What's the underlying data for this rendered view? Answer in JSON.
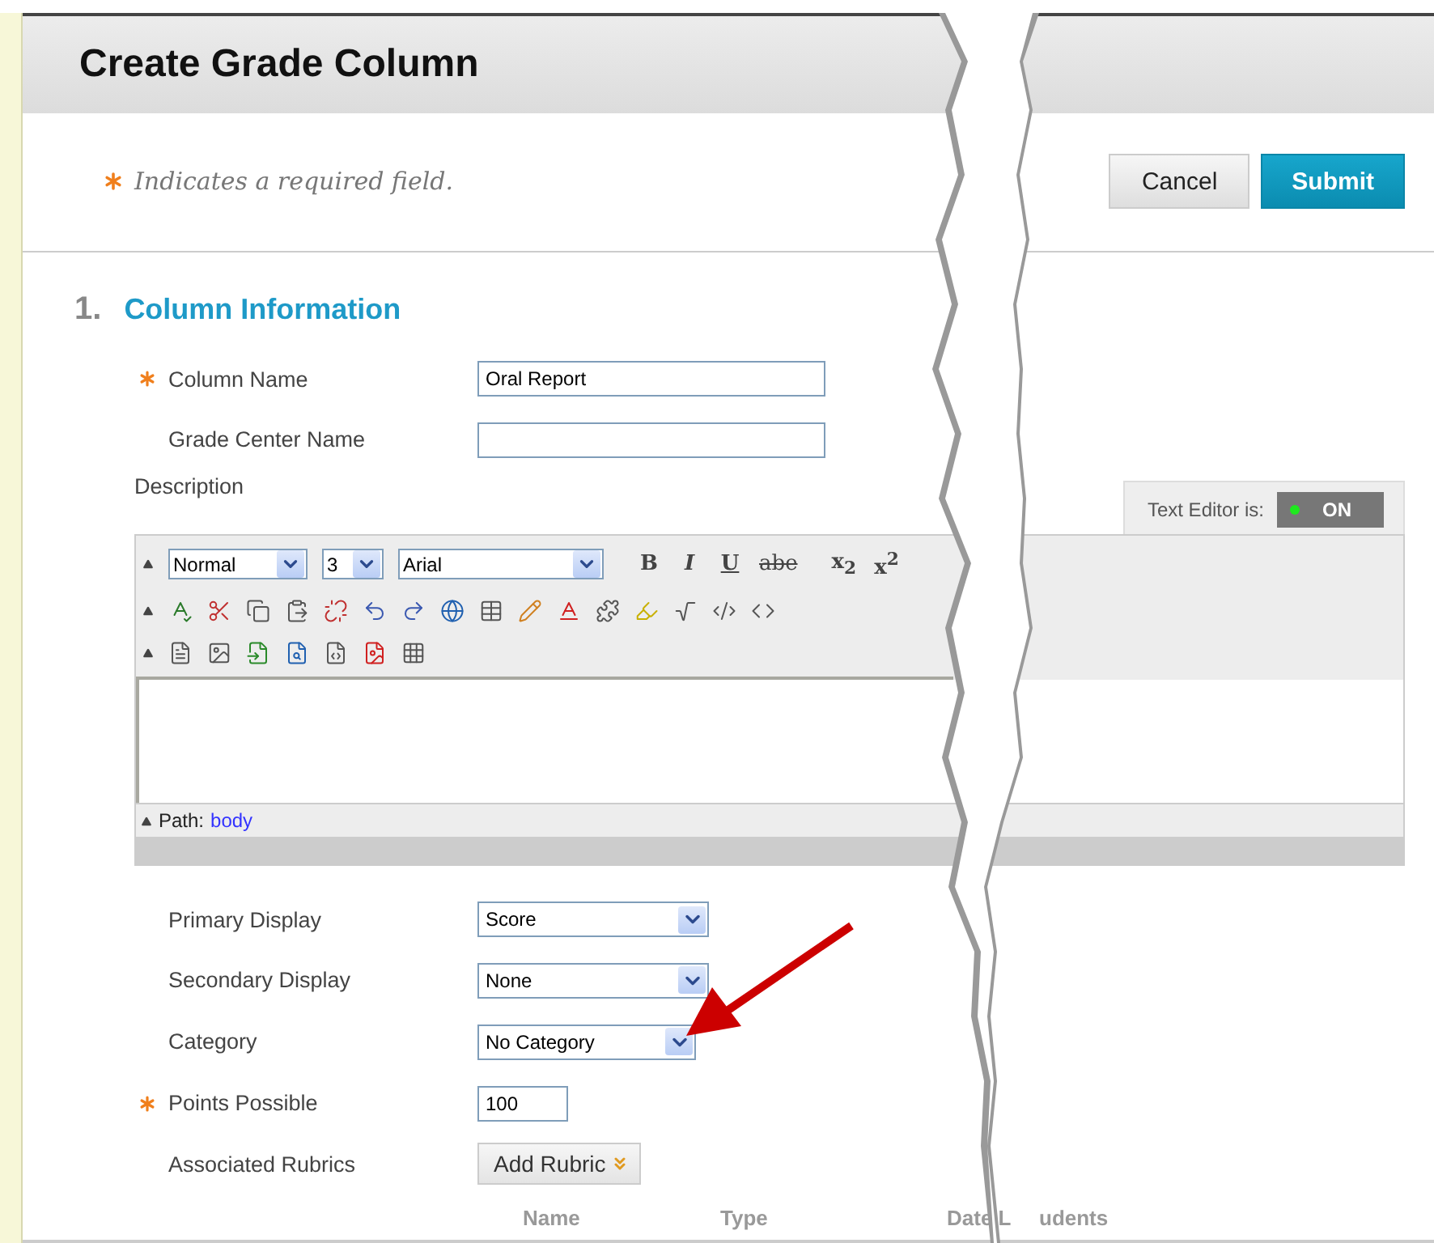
{
  "page": {
    "title": "Create Grade Column"
  },
  "required_note": {
    "text": "Indicates a required field."
  },
  "buttons": [
    {
      "label": "Cancel",
      "kind": "secondary"
    },
    {
      "label": "Submit",
      "kind": "primary"
    }
  ],
  "section": {
    "number": "1.",
    "title": "Column Information"
  },
  "fields_top": [
    {
      "kind": "text",
      "label": "Column Name",
      "required": true,
      "value": "Oral Report"
    },
    {
      "kind": "text",
      "label": "Grade Center Name",
      "required": false
    }
  ],
  "description": {
    "label": "Description"
  },
  "text_editor_toggle": {
    "label": "Text Editor is:",
    "state_text": "ON",
    "on": true
  },
  "editor": {
    "paragraph": "Normal",
    "size": "3",
    "font": "Arial",
    "format_buttons": [
      "B",
      "I",
      "U",
      "abe",
      "x$_{2}$",
      "x$^{2}$"
    ],
    "path_label": "Path:",
    "path": "body"
  },
  "fields_bottom": [
    {
      "kind": "select",
      "label": "Primary Display",
      "required": false,
      "value": "Score"
    },
    {
      "kind": "select",
      "label": "Secondary Display",
      "required": false,
      "value": "None"
    },
    {
      "kind": "select",
      "label": "Category",
      "required": false,
      "value": "No Category"
    },
    {
      "kind": "text",
      "label": "Points Possible",
      "required": true,
      "value": "100"
    },
    {
      "kind": "button",
      "label": "Associated Rubrics",
      "required": false,
      "value": "Add Rubric"
    }
  ],
  "rubrics_table": {
    "columns": [
      "Name",
      "Type",
      "Date L",
      "udents"
    ]
  }
}
